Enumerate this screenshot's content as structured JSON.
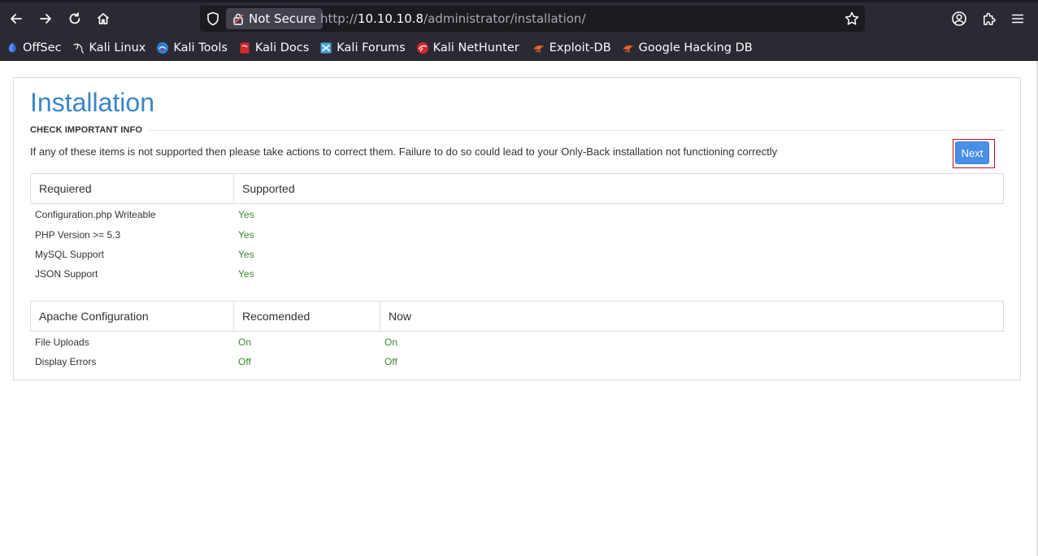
{
  "browser": {
    "security_label": "Not Secure",
    "url_prefix": "http://",
    "url_host": "10.10.10.8",
    "url_path": "/administrator/installation/",
    "bookmarks": [
      {
        "label": "OffSec",
        "icon": "offsec-icon",
        "color": "#3d6fe0"
      },
      {
        "label": "Kali Linux",
        "icon": "kali-dragon-icon",
        "color": "#e8e8e8"
      },
      {
        "label": "Kali Tools",
        "icon": "kali-tools-icon",
        "color": "#2f7fd6"
      },
      {
        "label": "Kali Docs",
        "icon": "kali-docs-icon",
        "color": "#d8262f"
      },
      {
        "label": "Kali Forums",
        "icon": "kali-forums-icon",
        "color": "#4aa3e0"
      },
      {
        "label": "Kali NetHunter",
        "icon": "nethunter-icon",
        "color": "#d8262f"
      },
      {
        "label": "Exploit-DB",
        "icon": "exploit-db-icon",
        "color": "#e8632a"
      },
      {
        "label": "Google Hacking DB",
        "icon": "ghdb-icon",
        "color": "#e8632a"
      }
    ]
  },
  "page": {
    "title": "Installation",
    "section": "CHECK IMPORTANT INFO",
    "info": "If any of these items is not supported then please take actions to correct them. Failure to do so could lead to your Only-Back installation not functioning correctly",
    "next_label": "Next",
    "requirements": {
      "headers": [
        "Requiered",
        "Supported"
      ],
      "rows": [
        {
          "name": "Configuration.php Writeable",
          "value": "Yes"
        },
        {
          "name": "PHP Version >= 5.3",
          "value": "Yes"
        },
        {
          "name": "MySQL Support",
          "value": "Yes"
        },
        {
          "name": "JSON Support",
          "value": "Yes"
        }
      ]
    },
    "apache": {
      "headers": [
        "Apache Configuration",
        "Recomended",
        "Now"
      ],
      "rows": [
        {
          "name": "File Uploads",
          "recommended": "On",
          "now": "On"
        },
        {
          "name": "Display Errors",
          "recommended": "Off",
          "now": "Off"
        }
      ]
    }
  },
  "colors": {
    "accent_title": "#3a86c8",
    "ok_green": "#3c8a2e",
    "next_button": "#4a8fe7",
    "highlight_box": "#c0121e"
  }
}
